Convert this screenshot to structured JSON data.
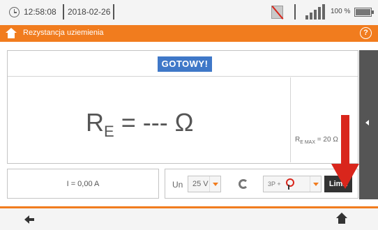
{
  "status_bar": {
    "time": "12:58:08",
    "date": "2018-02-26",
    "battery_percent": "100 %"
  },
  "title_bar": {
    "title": "Rezystancja uziemienia"
  },
  "main": {
    "status_badge": "GOTOWY!",
    "result_symbol": "R",
    "result_subscript": "E",
    "result_value": " = --- Ω",
    "limit_symbol": "R",
    "limit_subscript": "E MAX",
    "limit_value": " = 20 Ω"
  },
  "controls": {
    "current_reading": "I = 0,00 A",
    "un_label": "Un",
    "un_value": "25 V",
    "mode_value": "3P +",
    "limit_button_label": "Limit"
  },
  "colors": {
    "accent": "#f17c1e",
    "badge": "#3f78c8",
    "annotation_arrow": "#d9261c"
  },
  "icons": [
    "clock-icon",
    "no-signal-icon",
    "signal-strength-icon",
    "battery-icon",
    "home-icon",
    "help-icon",
    "side-arrow-icon",
    "clamp-icon",
    "probe-icon",
    "back-icon",
    "red-arrow-icon"
  ]
}
